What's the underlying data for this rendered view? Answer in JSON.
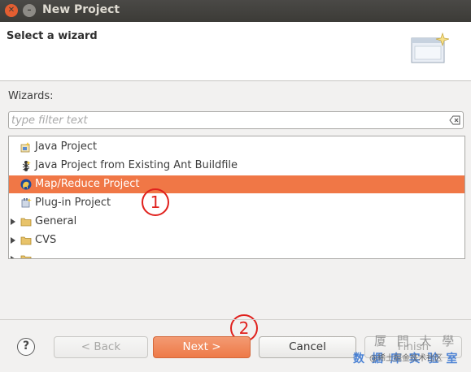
{
  "window": {
    "title": "New Project"
  },
  "header": {
    "title": "Select a wizard"
  },
  "wizards_label": "Wizards:",
  "filter": {
    "placeholder": "type filter text",
    "value": ""
  },
  "tree": {
    "items": [
      {
        "label": "Java Project",
        "icon": "java-project-icon",
        "expandable": false,
        "selected": false
      },
      {
        "label": "Java Project from Existing Ant Buildfile",
        "icon": "ant-buildfile-icon",
        "expandable": false,
        "selected": false
      },
      {
        "label": "Map/Reduce Project",
        "icon": "mapreduce-elephant-icon",
        "expandable": false,
        "selected": true
      },
      {
        "label": "Plug-in Project",
        "icon": "plugin-icon",
        "expandable": false,
        "selected": false
      },
      {
        "label": "General",
        "icon": "folder-icon",
        "expandable": true,
        "selected": false
      },
      {
        "label": "CVS",
        "icon": "folder-icon",
        "expandable": true,
        "selected": false
      }
    ]
  },
  "annotations": {
    "one": "1",
    "two": "2"
  },
  "buttons": {
    "help": "?",
    "back": "< Back",
    "next": "Next >",
    "cancel": "Cancel",
    "finish": "Finish"
  },
  "watermark": {
    "line1": "厦 門 大 學",
    "line2": "数 据 库 实 验 室",
    "line3": "@稀土掘金技术社区"
  },
  "colors": {
    "selection": "#f07746",
    "annotation": "#e0211d",
    "primary_button": "#ee7a48"
  }
}
